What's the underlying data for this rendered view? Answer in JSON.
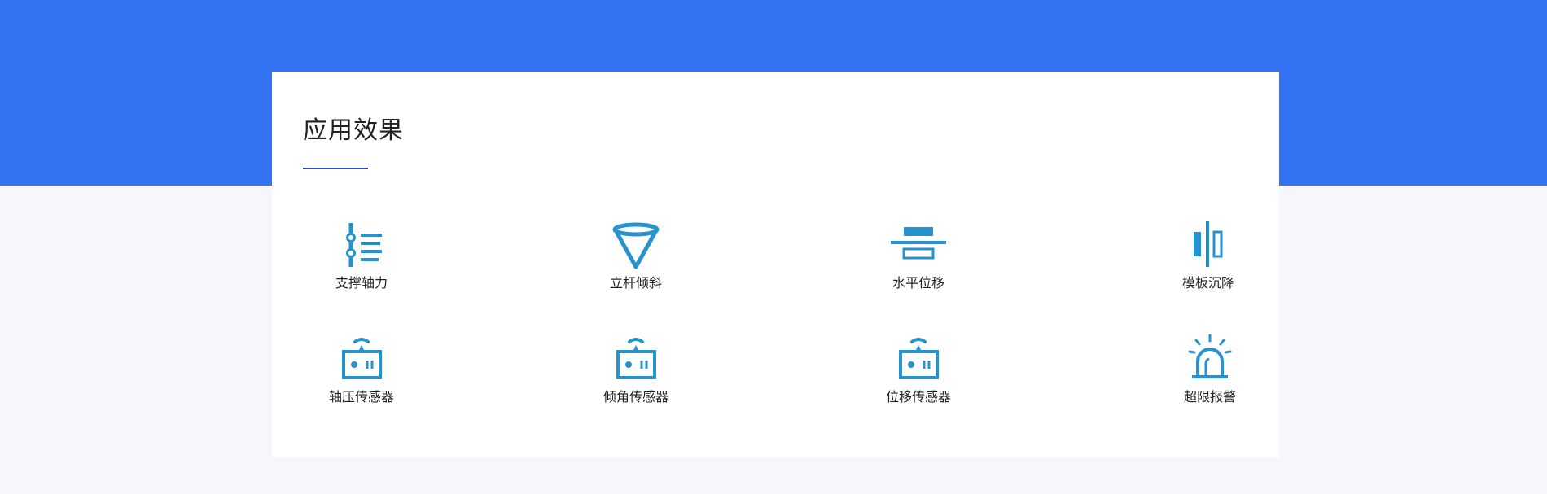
{
  "section": {
    "title": "应用效果"
  },
  "colors": {
    "band": "#3473f3",
    "icon": "#2793cc",
    "underline": "#2c4fb8",
    "card": "#ffffff",
    "page": "#f5f7fb"
  },
  "features": [
    {
      "label": "支撑轴力",
      "icon": "axial-force-icon"
    },
    {
      "label": "立杆倾斜",
      "icon": "funnel-tilt-icon"
    },
    {
      "label": "水平位移",
      "icon": "horizontal-displacement-icon"
    },
    {
      "label": "模板沉降",
      "icon": "formwork-settlement-icon"
    },
    {
      "label": "轴压传感器",
      "icon": "sensor-device-icon"
    },
    {
      "label": "倾角传感器",
      "icon": "sensor-device-icon"
    },
    {
      "label": "位移传感器",
      "icon": "sensor-device-icon"
    },
    {
      "label": "超限报警",
      "icon": "alarm-light-icon"
    }
  ]
}
